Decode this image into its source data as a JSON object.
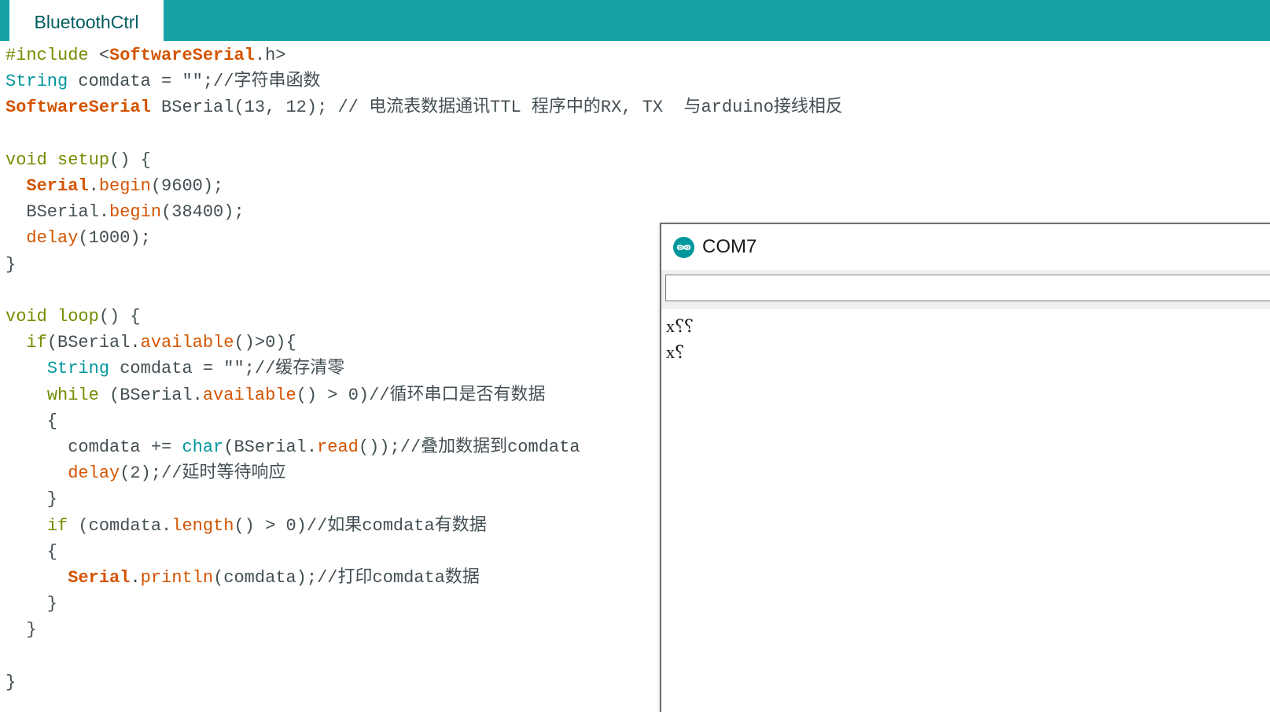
{
  "editor": {
    "tab_label": "BluetoothCtrl",
    "lines": [
      [
        {
          "t": "#include ",
          "c": "pre"
        },
        {
          "t": "<",
          "c": "plain"
        },
        {
          "t": "SoftwareSerial",
          "c": "lib"
        },
        {
          "t": ".h>",
          "c": "plain"
        }
      ],
      [
        {
          "t": "String",
          "c": "type"
        },
        {
          "t": " comdata = \"\";//字符串函数",
          "c": "plain"
        }
      ],
      [
        {
          "t": "SoftwareSerial",
          "c": "lib"
        },
        {
          "t": " BSerial(13, 12); // 电流表数据通讯TTL 程序中的RX, TX  与arduino接线相反",
          "c": "plain"
        }
      ],
      [],
      [
        {
          "t": "void",
          "c": "kw"
        },
        {
          "t": " ",
          "c": "plain"
        },
        {
          "t": "setup",
          "c": "kw"
        },
        {
          "t": "() {",
          "c": "plain"
        }
      ],
      [
        {
          "t": "  ",
          "c": "plain"
        },
        {
          "t": "Serial",
          "c": "ser"
        },
        {
          "t": ".",
          "c": "plain"
        },
        {
          "t": "begin",
          "c": "fn"
        },
        {
          "t": "(9600);",
          "c": "plain"
        }
      ],
      [
        {
          "t": "  BSerial.",
          "c": "plain"
        },
        {
          "t": "begin",
          "c": "fn"
        },
        {
          "t": "(38400);",
          "c": "plain"
        }
      ],
      [
        {
          "t": "  ",
          "c": "plain"
        },
        {
          "t": "delay",
          "c": "fn"
        },
        {
          "t": "(1000);",
          "c": "plain"
        }
      ],
      [
        {
          "t": "}",
          "c": "plain"
        }
      ],
      [],
      [
        {
          "t": "void",
          "c": "kw"
        },
        {
          "t": " ",
          "c": "plain"
        },
        {
          "t": "loop",
          "c": "kw"
        },
        {
          "t": "() {",
          "c": "plain"
        }
      ],
      [
        {
          "t": "  ",
          "c": "plain"
        },
        {
          "t": "if",
          "c": "kw"
        },
        {
          "t": "(BSerial.",
          "c": "plain"
        },
        {
          "t": "available",
          "c": "fn"
        },
        {
          "t": "()>0){",
          "c": "plain"
        }
      ],
      [
        {
          "t": "    ",
          "c": "plain"
        },
        {
          "t": "String",
          "c": "type"
        },
        {
          "t": " comdata = \"\";//缓存清零",
          "c": "plain"
        }
      ],
      [
        {
          "t": "    ",
          "c": "plain"
        },
        {
          "t": "while",
          "c": "kw"
        },
        {
          "t": " (BSerial.",
          "c": "plain"
        },
        {
          "t": "available",
          "c": "fn"
        },
        {
          "t": "() > 0)//循环串口是否有数据",
          "c": "plain"
        }
      ],
      [
        {
          "t": "    {",
          "c": "plain"
        }
      ],
      [
        {
          "t": "      comdata += ",
          "c": "plain"
        },
        {
          "t": "char",
          "c": "type"
        },
        {
          "t": "(BSerial.",
          "c": "plain"
        },
        {
          "t": "read",
          "c": "fn"
        },
        {
          "t": "());//叠加数据到comdata",
          "c": "plain"
        }
      ],
      [
        {
          "t": "      ",
          "c": "plain"
        },
        {
          "t": "delay",
          "c": "fn"
        },
        {
          "t": "(2);//延时等待响应",
          "c": "plain"
        }
      ],
      [
        {
          "t": "    }",
          "c": "plain"
        }
      ],
      [
        {
          "t": "    ",
          "c": "plain"
        },
        {
          "t": "if",
          "c": "kw"
        },
        {
          "t": " (comdata.",
          "c": "plain"
        },
        {
          "t": "length",
          "c": "fn"
        },
        {
          "t": "() > 0)//如果comdata有数据",
          "c": "plain"
        }
      ],
      [
        {
          "t": "    {",
          "c": "plain"
        }
      ],
      [
        {
          "t": "      ",
          "c": "plain"
        },
        {
          "t": "Serial",
          "c": "ser"
        },
        {
          "t": ".",
          "c": "plain"
        },
        {
          "t": "println",
          "c": "fn"
        },
        {
          "t": "(comdata);//打印comdata数据",
          "c": "plain"
        }
      ],
      [
        {
          "t": "    }",
          "c": "plain"
        }
      ],
      [
        {
          "t": "  }",
          "c": "plain"
        }
      ],
      [],
      [
        {
          "t": "}",
          "c": "plain"
        }
      ]
    ]
  },
  "serial_monitor": {
    "title": "COM7",
    "icon": "arduino-infinity-icon",
    "input_value": "",
    "output_lines": [
      "x⸮⸮",
      "x⸮"
    ]
  },
  "colors": {
    "tabbar": "#17a1a5",
    "keyword_green": "#728e00",
    "library_orange": "#d35400",
    "type_teal": "#00979c",
    "plain_text": "#434f54"
  }
}
